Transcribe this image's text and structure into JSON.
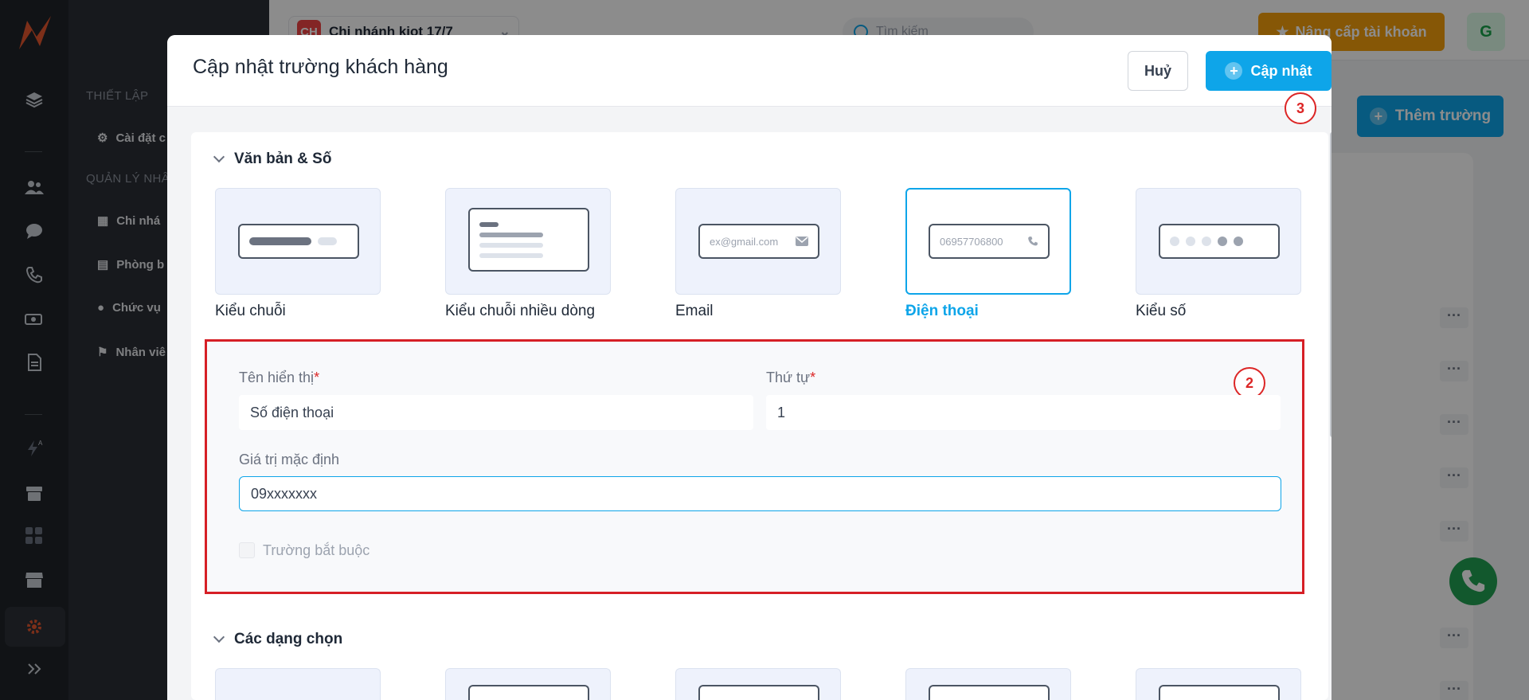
{
  "app": {
    "branch_badge": "CH",
    "branch_name": "Chi nhánh kiot 17/7",
    "search_placeholder": "Tìm kiếm",
    "upgrade_label": "Nâng cấp tài khoản",
    "avatar_letter": "G",
    "add_field_label": "Thêm trường"
  },
  "nav": {
    "section_setup": "THIẾT LẬP",
    "item_settings": "Cài đặt c",
    "section_manage": "QUẢN LÝ NHÂ",
    "item_branch": "Chi nhá",
    "item_room": "Phòng b",
    "item_role": "Chức vụ",
    "item_staff": "Nhân viê"
  },
  "modal": {
    "title": "Cập nhật trường khách hàng",
    "cancel_label": "Huỷ",
    "update_label": "Cập nhật",
    "marker_3": "3",
    "marker_2": "2",
    "group_text_number": "Văn bản & Số",
    "group_choices": "Các dạng chọn",
    "types": [
      {
        "label": "Kiểu chuỗi",
        "selected": false
      },
      {
        "label": "Kiểu chuỗi nhiều dòng",
        "selected": false
      },
      {
        "label": "Email",
        "selected": false,
        "sample": "ex@gmail.com"
      },
      {
        "label": "Điện thoại",
        "selected": true,
        "sample": "06957706800"
      },
      {
        "label": "Kiểu số",
        "selected": false
      }
    ],
    "form": {
      "display_name_label": "Tên hiển thị",
      "display_name_value": "Số điện thoại",
      "order_label": "Thứ tự",
      "order_value": "1",
      "required_mark": "*",
      "default_value_label": "Giá trị mặc định",
      "default_value": "09xxxxxxx",
      "required_checkbox_label": "Trường bắt buộc",
      "required_checked": false
    }
  },
  "colors": {
    "accent": "#0ea5e9",
    "highlight_red": "#d61f26",
    "upgrade": "#f59e0b",
    "fab_green": "#22a052"
  }
}
